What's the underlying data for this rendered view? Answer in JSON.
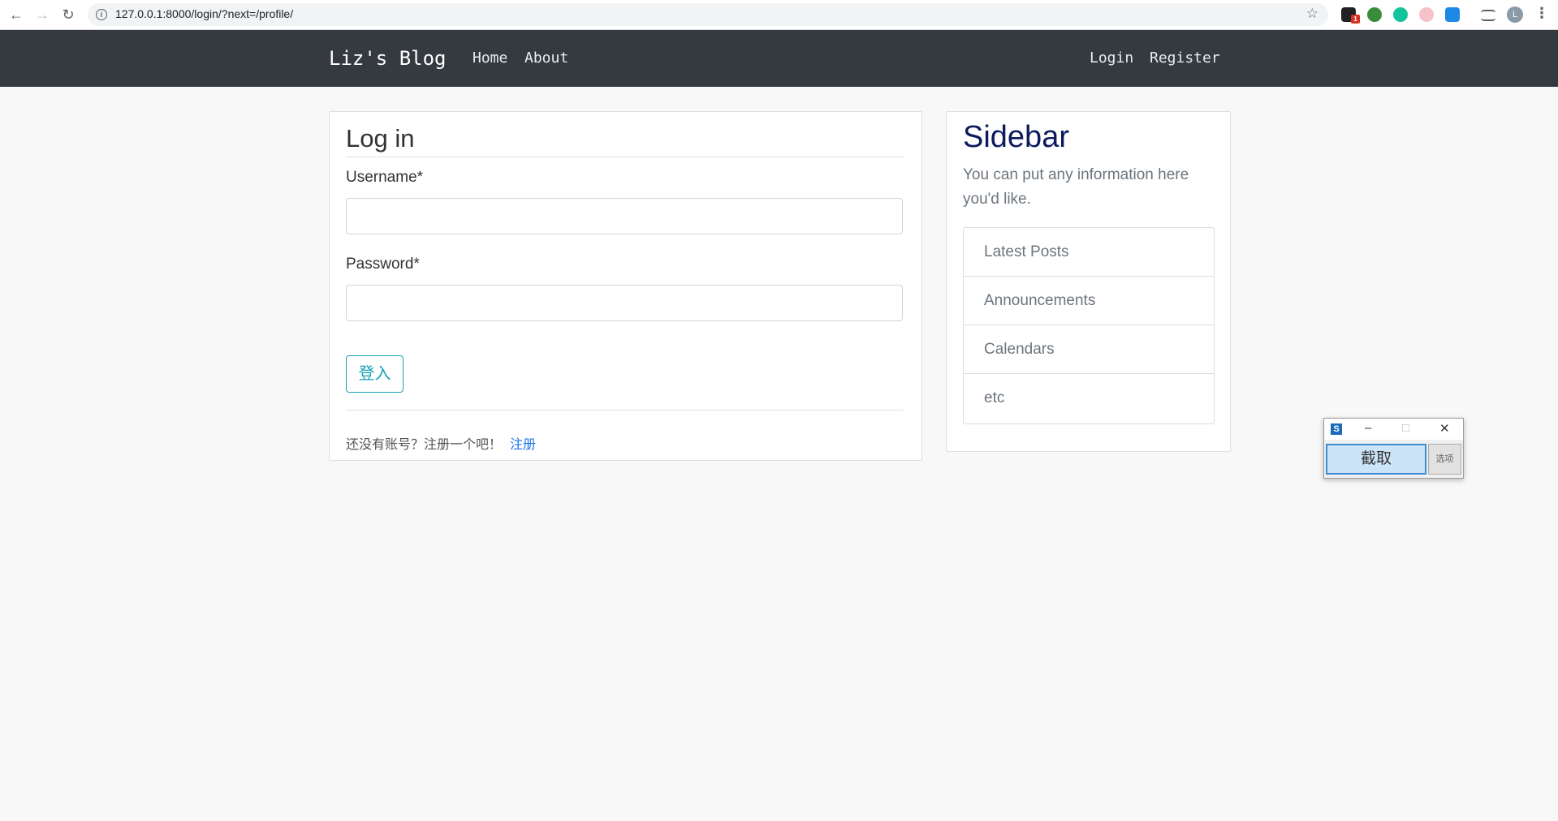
{
  "browser": {
    "url": "127.0.0.1:8000/login/?next=/profile/",
    "extension_badge": "1",
    "profile_initial": "L"
  },
  "navbar": {
    "brand": "Liz's Blog",
    "links": [
      "Home",
      "About"
    ],
    "auth_links": [
      "Login",
      "Register"
    ]
  },
  "login": {
    "title": "Log in",
    "username_label": "Username*",
    "username_value": "",
    "password_label": "Password*",
    "password_value": "",
    "submit_label": "登入",
    "register_prompt": "还没有账号？注册一个吧！",
    "register_link": "注册"
  },
  "sidebar": {
    "title": "Sidebar",
    "description": "You can put any information here you'd like.",
    "items": [
      "Latest Posts",
      "Announcements",
      "Calendars",
      "etc"
    ]
  },
  "capture_tool": {
    "capture_label": "截取",
    "options_label": "选项"
  },
  "colors": {
    "navbar_bg": "#343a40",
    "page_bg": "#f8f8f8",
    "accent": "#17a2b8",
    "link": "#1a73e8"
  }
}
